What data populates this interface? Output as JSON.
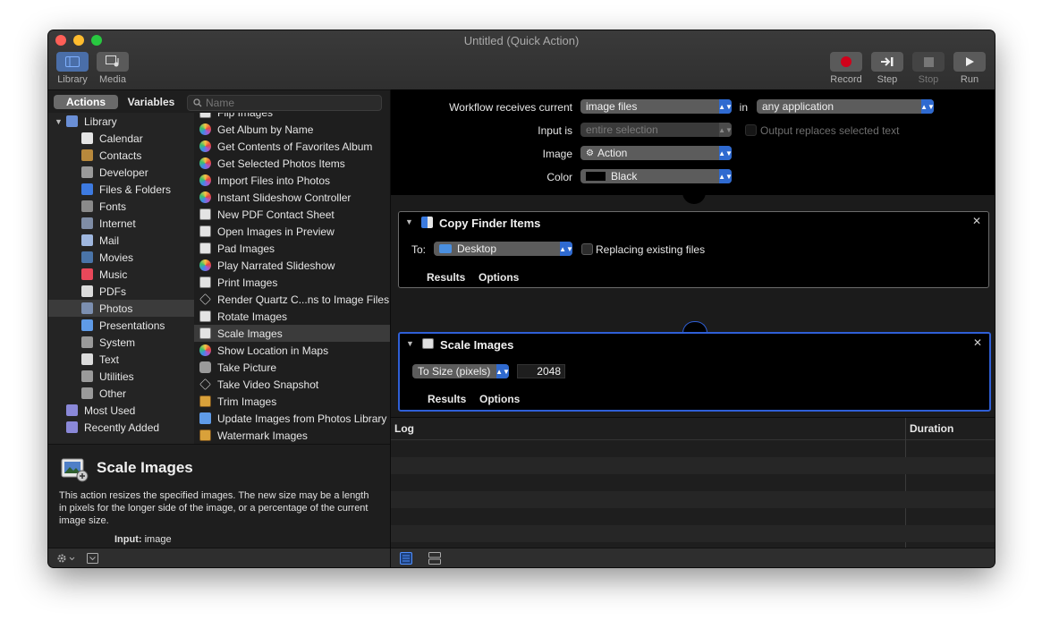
{
  "window": {
    "title": "Untitled (Quick Action)"
  },
  "toolbar": {
    "library": "Library",
    "media": "Media",
    "record": "Record",
    "step": "Step",
    "stop": "Stop",
    "run": "Run"
  },
  "library_pane": {
    "tab_actions": "Actions",
    "tab_variables": "Variables",
    "search_placeholder": "Name",
    "categories": [
      {
        "label": "Library",
        "icon": "library-icon",
        "color": "#6a8fd6"
      },
      {
        "label": "Calendar",
        "icon": "calendar-icon",
        "color": "#e5e5e5"
      },
      {
        "label": "Contacts",
        "icon": "contacts-icon",
        "color": "#b8893c"
      },
      {
        "label": "Developer",
        "icon": "developer-icon",
        "color": "#9a9a9a"
      },
      {
        "label": "Files & Folders",
        "icon": "finder-icon",
        "color": "#3d7ae0"
      },
      {
        "label": "Fonts",
        "icon": "fonts-icon",
        "color": "#8a8a8a"
      },
      {
        "label": "Internet",
        "icon": "internet-icon",
        "color": "#7f8da6"
      },
      {
        "label": "Mail",
        "icon": "mail-icon",
        "color": "#9fb7df"
      },
      {
        "label": "Movies",
        "icon": "movies-icon",
        "color": "#4a74a8"
      },
      {
        "label": "Music",
        "icon": "music-icon",
        "color": "#e9485a"
      },
      {
        "label": "PDFs",
        "icon": "pdf-icon",
        "color": "#dcdcdc"
      },
      {
        "label": "Photos",
        "icon": "photos-icon",
        "color": "#7c8fb0"
      },
      {
        "label": "Presentations",
        "icon": "presentations-icon",
        "color": "#5f9be8"
      },
      {
        "label": "System",
        "icon": "system-icon",
        "color": "#9a9a9a"
      },
      {
        "label": "Text",
        "icon": "text-icon",
        "color": "#dcdcdc"
      },
      {
        "label": "Utilities",
        "icon": "utilities-icon",
        "color": "#9a9a9a"
      },
      {
        "label": "Other",
        "icon": "other-icon",
        "color": "#9a9a9a"
      },
      {
        "label": "Most Used",
        "icon": "smart-folder-icon",
        "color": "#8a88d8"
      },
      {
        "label": "Recently Added",
        "icon": "smart-folder-icon",
        "color": "#8a88d8"
      }
    ],
    "selected_category": "Photos",
    "actions": [
      {
        "label": "Flip Images",
        "icon": "image-action-icon"
      },
      {
        "label": "Get Album by Name",
        "icon": "photos-app-icon"
      },
      {
        "label": "Get Contents of Favorites Album",
        "icon": "photos-app-icon"
      },
      {
        "label": "Get Selected Photos Items",
        "icon": "photos-app-icon"
      },
      {
        "label": "Import Files into Photos",
        "icon": "photos-app-icon"
      },
      {
        "label": "Instant Slideshow Controller",
        "icon": "photos-app-icon"
      },
      {
        "label": "New PDF Contact Sheet",
        "icon": "image-action-icon"
      },
      {
        "label": "Open Images in Preview",
        "icon": "image-action-icon"
      },
      {
        "label": "Pad Images",
        "icon": "image-action-icon"
      },
      {
        "label": "Play Narrated Slideshow",
        "icon": "photos-app-icon"
      },
      {
        "label": "Print Images",
        "icon": "image-action-icon"
      },
      {
        "label": "Render Quartz C...ns to Image Files",
        "icon": "quartz-icon"
      },
      {
        "label": "Rotate Images",
        "icon": "image-action-icon"
      },
      {
        "label": "Scale Images",
        "icon": "image-action-icon"
      },
      {
        "label": "Show Location in Maps",
        "icon": "photos-app-icon"
      },
      {
        "label": "Take Picture",
        "icon": "camera-icon"
      },
      {
        "label": "Take Video Snapshot",
        "icon": "quartz-icon"
      },
      {
        "label": "Trim Images",
        "icon": "trim-icon"
      },
      {
        "label": "Update Images from Photos Library",
        "icon": "presentations-icon"
      },
      {
        "label": "Watermark Images",
        "icon": "trim-icon"
      }
    ],
    "selected_action": "Scale Images",
    "description": {
      "title": "Scale Images",
      "body": "This action resizes the specified images. The new size may be a length in pixels for the longer side of the image, or a percentage of the current image size.",
      "input_label": "Input:",
      "input_value": "image"
    }
  },
  "workflow": {
    "receives_label": "Workflow receives current",
    "receives_value": "image files",
    "in_label": "in",
    "in_value": "any application",
    "input_is_label": "Input is",
    "input_is_value": "entire selection",
    "output_replaces": "Output replaces selected text",
    "image_label": "Image",
    "image_value": "Action",
    "color_label": "Color",
    "color_value": "Black",
    "actions": [
      {
        "title": "Copy Finder Items",
        "to_label": "To:",
        "to_value": "Desktop",
        "replacing": "Replacing existing files",
        "results": "Results",
        "options": "Options"
      },
      {
        "title": "Scale Images",
        "mode_value": "To Size (pixels)",
        "size_value": "2048",
        "results": "Results",
        "options": "Options"
      }
    ]
  },
  "log": {
    "col_log": "Log",
    "col_duration": "Duration"
  },
  "colors": {
    "accent": "#2f6ad0",
    "record_red": "#d0021b"
  }
}
